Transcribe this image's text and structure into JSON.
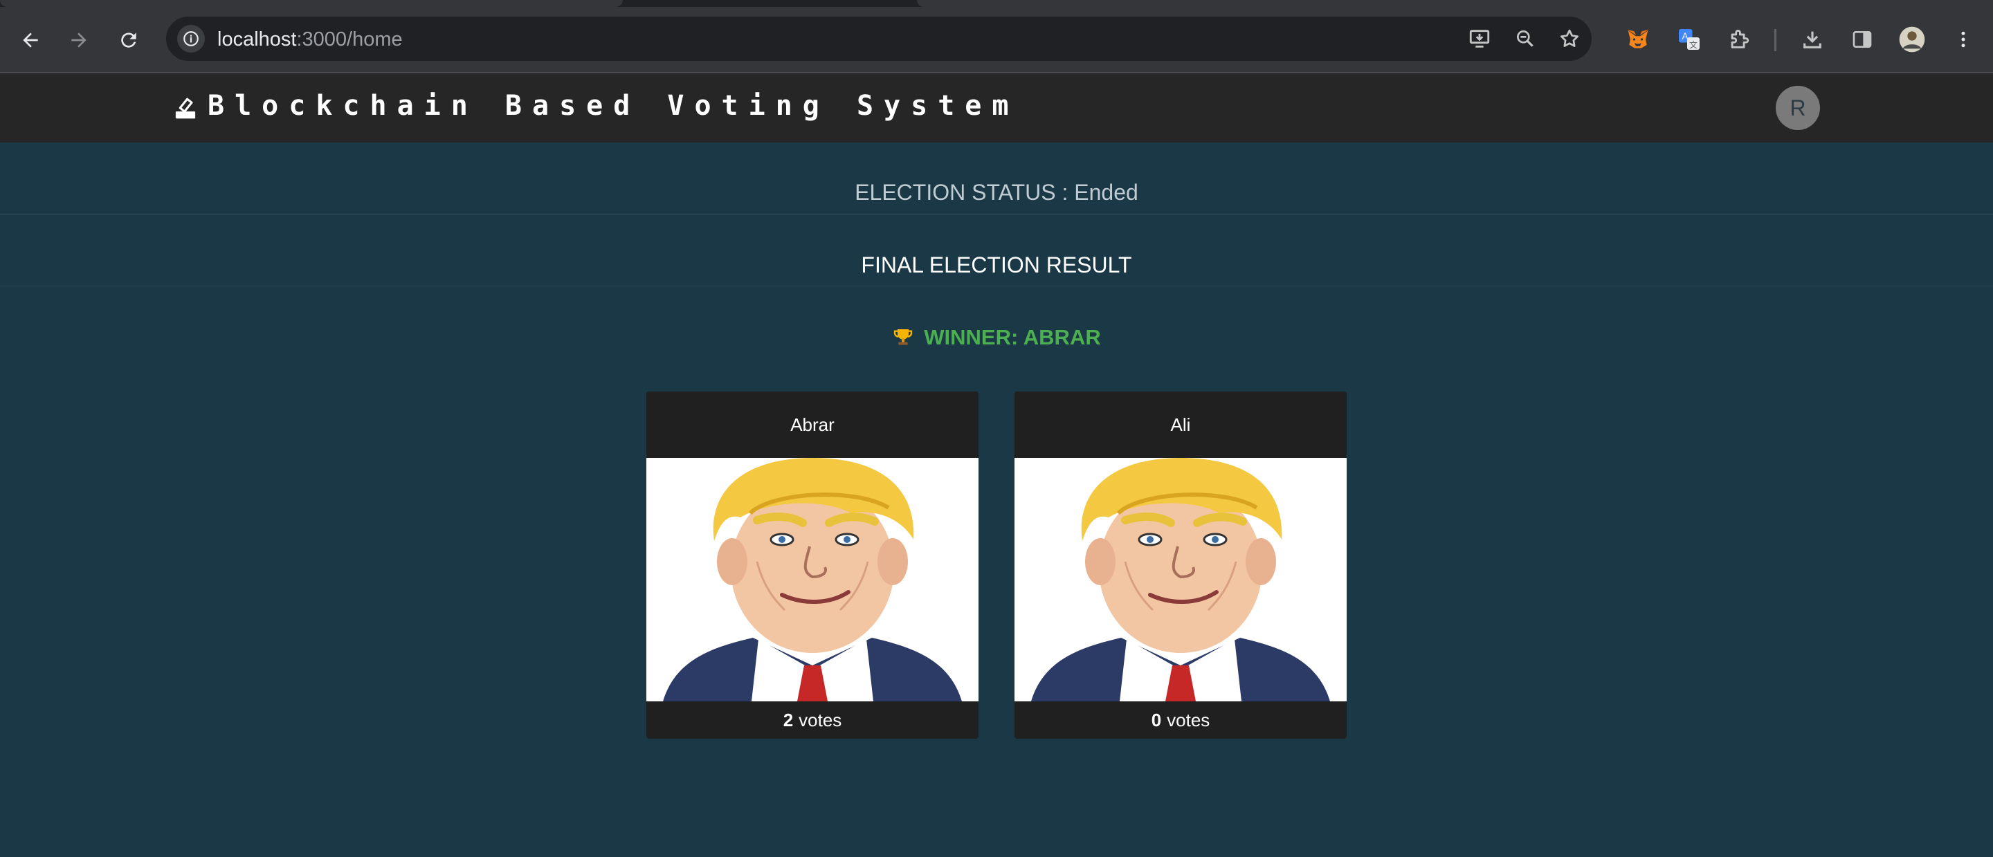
{
  "browser": {
    "url_host": "localhost",
    "url_path": ":3000/home"
  },
  "app": {
    "title": "Blockchain Based Voting System",
    "avatar_initial": "R"
  },
  "election": {
    "status_text": "ELECTION STATUS : Ended",
    "final_heading": "FINAL ELECTION RESULT",
    "winner_text": "WINNER: ABRAR",
    "winner_icon": "trophy-icon"
  },
  "candidates": [
    {
      "name": "Abrar",
      "votes": "2",
      "votes_label": "votes"
    },
    {
      "name": "Ali",
      "votes": "0",
      "votes_label": "votes"
    }
  ],
  "colors": {
    "page_bg": "#1b3847",
    "header_bg": "#262626",
    "card_bg": "#202020",
    "winner_green": "#4caf50"
  }
}
